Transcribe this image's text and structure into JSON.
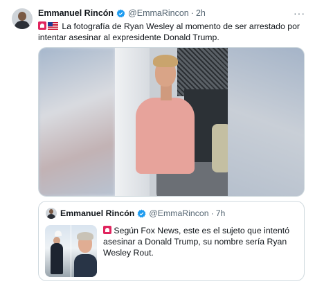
{
  "tweet": {
    "author_name": "Emmanuel Rincón",
    "handle": "@EmmaRincon",
    "separator": "·",
    "time": "2h",
    "more_label": "···",
    "emoji_icons": [
      "siren-icon",
      "us-flag-icon"
    ],
    "text": "La fotografía de Ryan Wesley al momento de ser arrestado por intentar asesinar al expresidente Donald Trump."
  },
  "quote": {
    "author_name": "Emmanuel Rincón",
    "handle": "@EmmaRincon",
    "separator": "·",
    "time": "7h",
    "emoji_icons": [
      "siren-icon"
    ],
    "text": "Según Fox News, este es el sujeto que intentó asesinar a Donald Trump, su nombre sería Ryan Wesley Rout."
  },
  "colors": {
    "verified": "#1d9bf0",
    "secondary_text": "#536471",
    "border": "#cfd9de",
    "siren": "#e0245e"
  }
}
